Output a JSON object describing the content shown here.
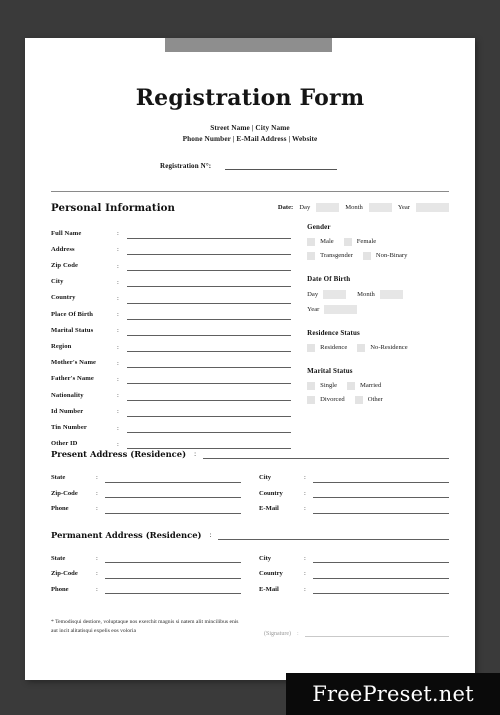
{
  "document": {
    "title": "Registration Form",
    "subtitle_line1": "Street Name | City Name",
    "subtitle_line2": "Phone Number | E-Mail Address | Website",
    "registration_label": "Registration N°:",
    "registration_value": ""
  },
  "personal": {
    "section_title": "Personal Information",
    "date_label": "Date:",
    "date_day_label": "Day",
    "date_month_label": "Month",
    "date_year_label": "Year",
    "date_day_value": "",
    "date_month_value": "",
    "date_year_value": "",
    "colon": ":",
    "fields": [
      {
        "label": "Full Name",
        "value": ""
      },
      {
        "label": "Address",
        "value": ""
      },
      {
        "label": "Zip Code",
        "value": ""
      },
      {
        "label": "City",
        "value": ""
      },
      {
        "label": "Country",
        "value": ""
      },
      {
        "label": "Place Of Birth",
        "value": ""
      },
      {
        "label": "Marital Status",
        "value": ""
      },
      {
        "label": "Region",
        "value": ""
      },
      {
        "label": "Mother's Name",
        "value": ""
      },
      {
        "label": "Father's Name",
        "value": ""
      },
      {
        "label": "Nationality",
        "value": ""
      },
      {
        "label": "Id Number",
        "value": ""
      },
      {
        "label": "Tin Number",
        "value": ""
      },
      {
        "label": "Other ID",
        "value": ""
      }
    ]
  },
  "gender": {
    "title": "Gender",
    "options_row1": [
      "Male",
      "Female"
    ],
    "options_row2": [
      "Transgender",
      "Non-Binary"
    ]
  },
  "date_of_birth": {
    "title": "Date Of Birth",
    "day_label": "Day",
    "month_label": "Month",
    "year_label": "Year",
    "day_value": "",
    "month_value": "",
    "year_value": ""
  },
  "residence_status": {
    "title": "Residence Status",
    "options": [
      "Residence",
      "No-Residence"
    ]
  },
  "marital_status": {
    "title": "Marital Status",
    "options_row1": [
      "Single",
      "Married"
    ],
    "options_row2": [
      "Divorced",
      "Other"
    ]
  },
  "present_address": {
    "title": "Present Address (Residence)",
    "colon": ":",
    "value": "",
    "left_fields": [
      {
        "label": "State",
        "value": ""
      },
      {
        "label": "Zip-Code",
        "value": ""
      },
      {
        "label": "Phone",
        "value": ""
      }
    ],
    "right_fields": [
      {
        "label": "City",
        "value": ""
      },
      {
        "label": "Country",
        "value": ""
      },
      {
        "label": "E-Mail",
        "value": ""
      }
    ]
  },
  "permanent_address": {
    "title": "Permanent Address (Residence)",
    "colon": ":",
    "value": "",
    "left_fields": [
      {
        "label": "State",
        "value": ""
      },
      {
        "label": "Zip-Code",
        "value": ""
      },
      {
        "label": "Phone",
        "value": ""
      }
    ],
    "right_fields": [
      {
        "label": "City",
        "value": ""
      },
      {
        "label": "Country",
        "value": ""
      },
      {
        "label": "E-Mail",
        "value": ""
      }
    ]
  },
  "footer": {
    "disclaimer": "* Temodisqui destiore, voluptaque nos exerchit magnis si natem alit mincilibus enis aut incit alitatisqui expelis eos voloria",
    "signature_label": "(Signature)",
    "signature_colon": ":",
    "signature_value": ""
  },
  "watermark": {
    "text": "FreePreset.net"
  },
  "colors": {
    "page_background": "#3a3a3a",
    "paper": "#ffffff",
    "top_bar": "#8e8e8e",
    "field_line": "#606060",
    "checkbox_fill": "#e3e3e3",
    "input_fill": "#e6e6e6",
    "watermark_background": "#0a0a0a",
    "text": "#111111"
  }
}
